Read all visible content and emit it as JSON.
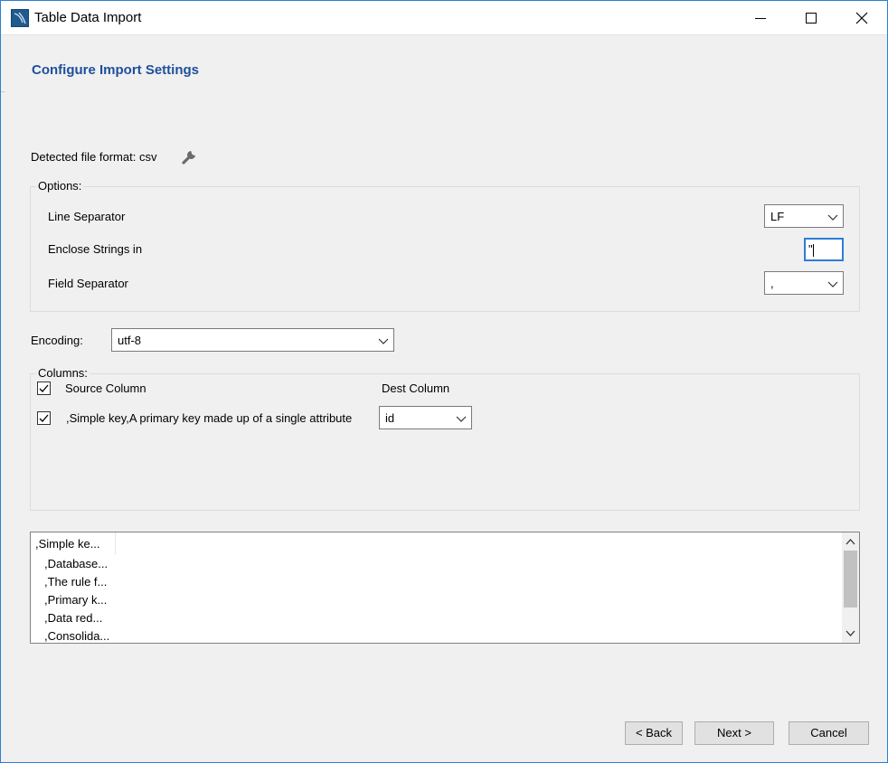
{
  "window": {
    "title": "Table Data Import",
    "minimize_icon": "minimize-icon",
    "maximize_icon": "maximize-icon",
    "close_icon": "close-icon"
  },
  "page": {
    "heading": "Configure Import Settings"
  },
  "detected": {
    "label": "Detected file format: csv",
    "icon": "wrench-icon"
  },
  "options": {
    "legend": "Options:",
    "line_separator_label": "Line Separator",
    "line_separator_value": "LF",
    "enclose_label": "Enclose Strings in",
    "enclose_value": "\"",
    "field_separator_label": "Field Separator",
    "field_separator_value": ","
  },
  "encoding": {
    "label": "Encoding:",
    "value": "utf-8"
  },
  "columns": {
    "legend": "Columns:",
    "source_header": "Source Column",
    "dest_header": "Dest Column",
    "header_checked": true,
    "rows": [
      {
        "checked": true,
        "source": ",Simple key,A primary key made up of a single attribute",
        "dest": "id"
      }
    ]
  },
  "preview": {
    "header": ",Simple ke...",
    "rows": [
      ",Database...",
      ",The rule f...",
      ",Primary k...",
      ",Data red...",
      ",Consolida..."
    ]
  },
  "buttons": {
    "back": "< Back",
    "next": "Next >",
    "cancel": "Cancel"
  },
  "colors": {
    "heading": "#1e4f9c",
    "focus_border": "#2e7dd6"
  }
}
